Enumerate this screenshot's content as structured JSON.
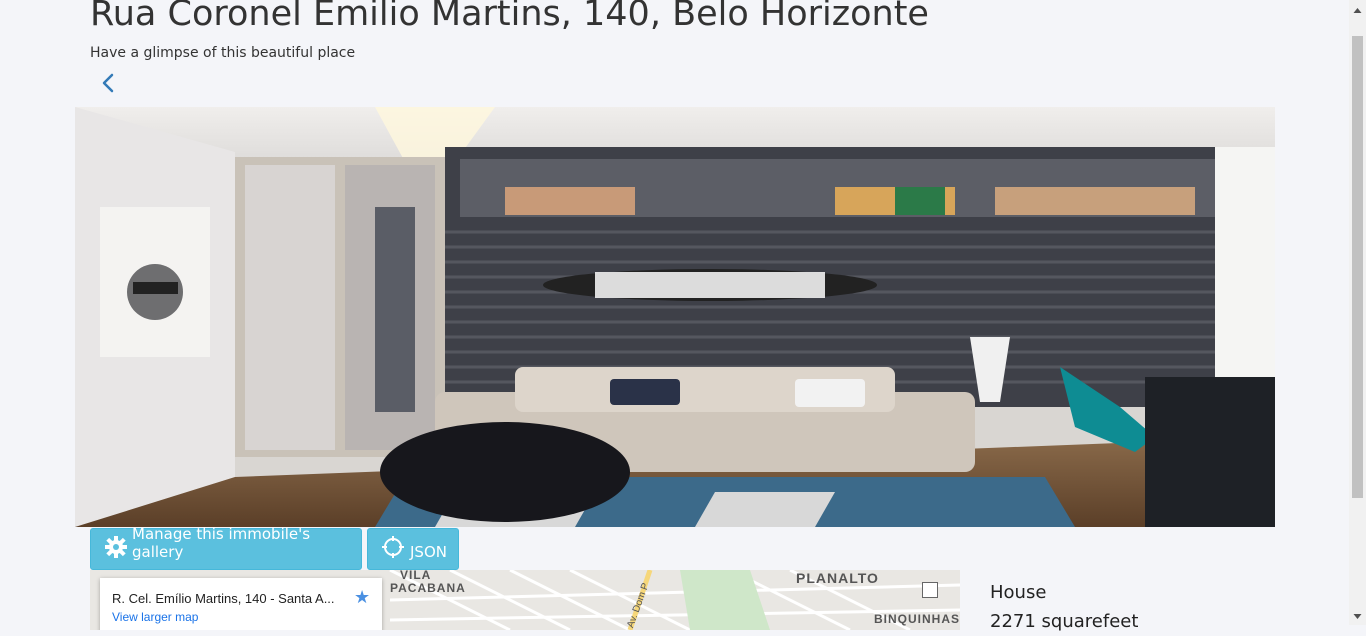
{
  "page": {
    "title": "Rua Coronel Emilio Martins, 140, Belo Horizonte",
    "subtitle": "Have a glimpse of this beautiful place"
  },
  "actions": {
    "gallery_label": "Manage this immobile's gallery",
    "json_label": "JSON"
  },
  "map": {
    "address": "R. Cel. Emílio Martins, 140 - Santa A...",
    "larger_map_link": "View larger map",
    "labels": {
      "vila": "VILA",
      "pacabana": "PACABANA",
      "planalto": "PLANALTO",
      "binquinhas": "BINQUINHAS",
      "street": "Av. Dom P"
    }
  },
  "property": {
    "type": "House",
    "area": "2271 squarefeet"
  },
  "colors": {
    "button_bg": "#5bc0de",
    "link": "#337ab7",
    "background": "#f4f5f9"
  },
  "icons": {
    "back": "chevron-left-icon",
    "gallery": "gear-icon",
    "json": "crosshair-icon",
    "map_save": "star-icon"
  }
}
